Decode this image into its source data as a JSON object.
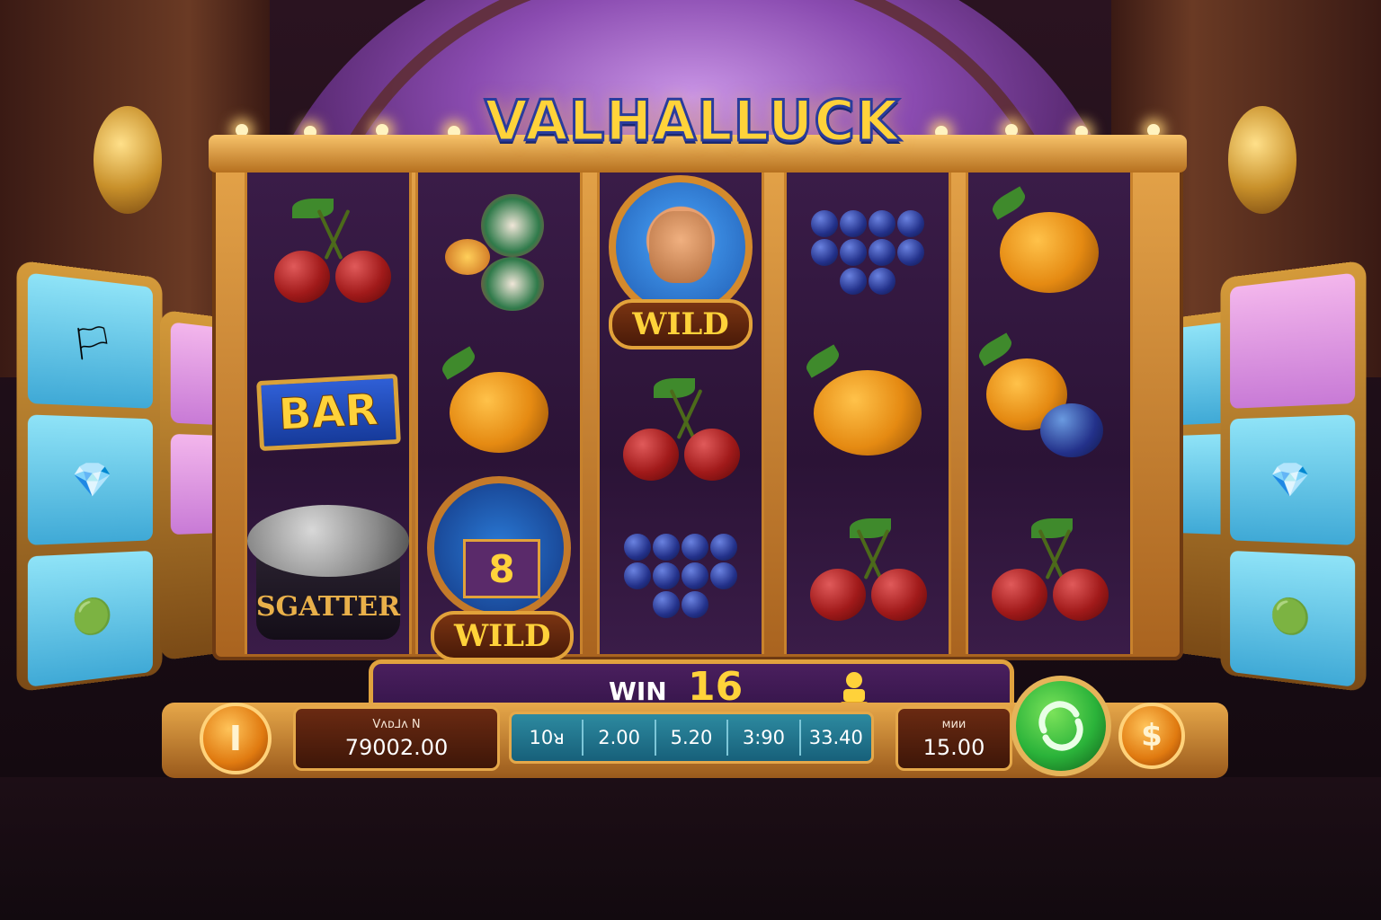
{
  "game": {
    "title": "VALHALLUCK"
  },
  "reels": [
    {
      "symbols": [
        "cherry",
        "bar",
        "scatter"
      ],
      "labels": [
        "",
        "BAR",
        "SGATTER"
      ]
    },
    {
      "symbols": [
        "gems",
        "orange",
        "multiplier-wild"
      ],
      "labels": [
        "",
        "",
        "WILD"
      ],
      "multiplier": "8"
    },
    {
      "symbols": [
        "viking-wild",
        "cherry",
        "grapes"
      ],
      "labels": [
        "WILD",
        "",
        ""
      ]
    },
    {
      "symbols": [
        "grapes",
        "orange",
        "cherry"
      ],
      "labels": [
        "",
        "",
        ""
      ]
    },
    {
      "symbols": [
        "orange",
        "orange-grapes",
        "cherry"
      ],
      "labels": [
        "",
        "",
        ""
      ]
    }
  ],
  "hud": {
    "win_label": "WIN",
    "win_value": "16",
    "balance_label": "Vᴧᴅ⅃ᴧ N",
    "balance_value": "79002.00",
    "bet_options": [
      "10ᴚ",
      "2.00",
      "5.20",
      "3:90",
      "33.40"
    ],
    "total_bet_label": "ᴍᴎᴎ",
    "total_bet_value": "15.00",
    "info_button_glyph": "I",
    "autoplay_button_glyph": "$"
  },
  "colors": {
    "gold": "#ffd23a",
    "spin_green": "#2bb33a",
    "panel_blue": "#17607a",
    "reel_purple": "#2b1336"
  }
}
